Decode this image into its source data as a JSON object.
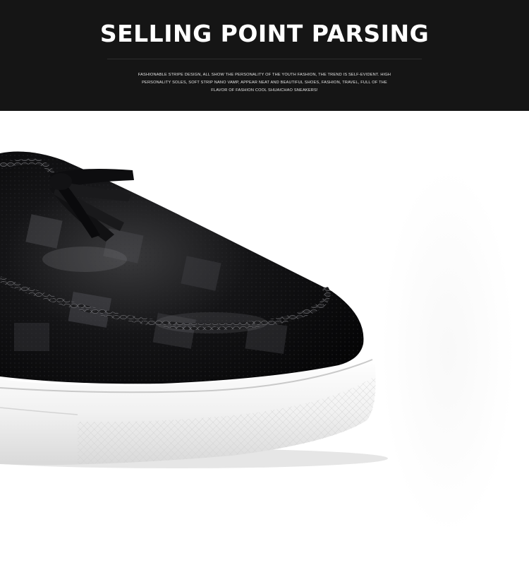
{
  "banner": {
    "title": "SELLING POINT PARSING",
    "description": "FASHIONABLE STRIPE DESIGN, ALL SHOW THE PERSONALITY OF THE YOUTH FASHION, THE TREND IS SELF-EVIDENT. HIGH PERSONALITY SOLES, SOFT STRIP NANO VAMP, APPEAR NEAT AND BEAUTIFUL SHOES, FASHION, TRAVEL, FULL OF THE FLAVOR OF FASHION COOL SHUAICHAO SNEAKERS!"
  },
  "product_photo": {
    "subject": "black patent leather loafer sneaker toe with tassels and white sole",
    "colors": {
      "leather": "#0b0b0c",
      "sole": "#f2f2f2",
      "banner_bg": "#151515"
    }
  }
}
